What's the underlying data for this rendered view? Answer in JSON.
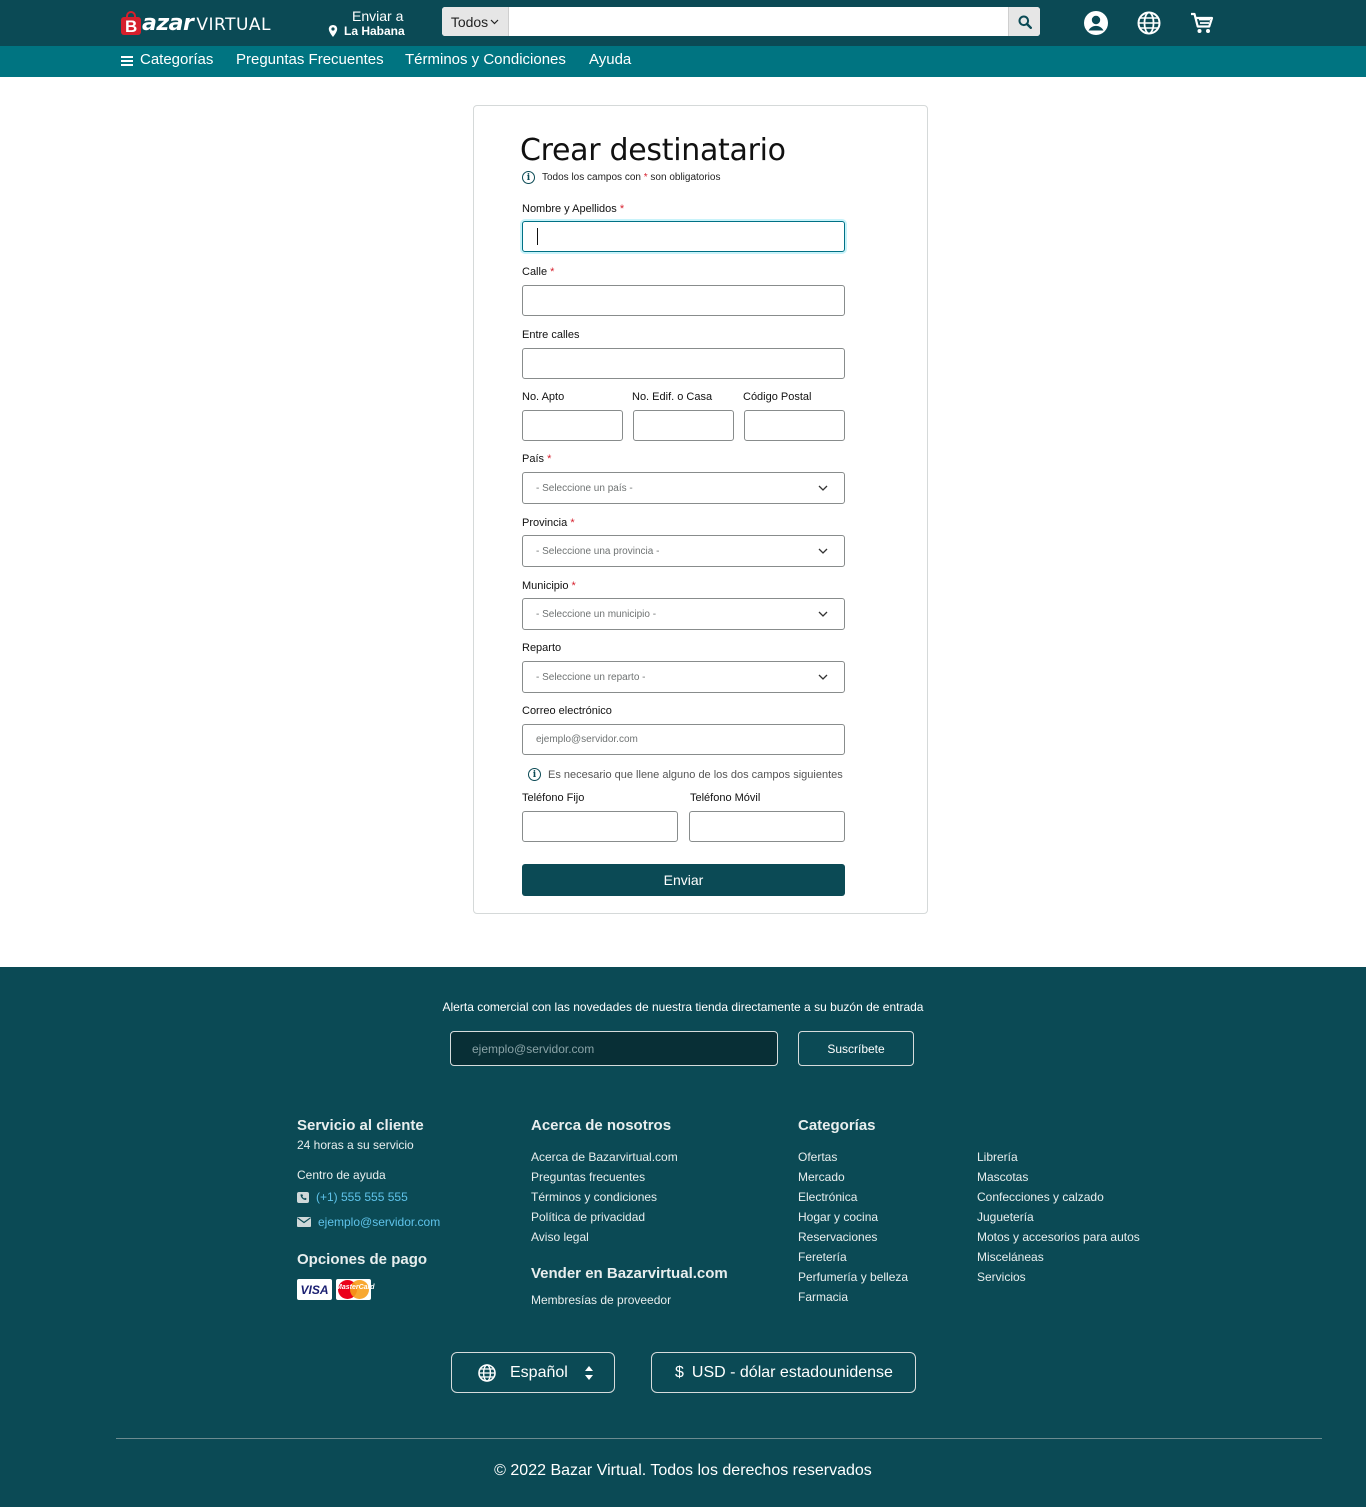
{
  "header": {
    "logo_letter": "B",
    "logo_bold": "azar",
    "logo_light": "VIRTUAL",
    "deliver_line1": "Enviar a",
    "deliver_line2": "La Habana",
    "search_category": "Todos",
    "search_placeholder": "",
    "icons": [
      "account-icon",
      "globe-icon",
      "cart-icon"
    ]
  },
  "nav": {
    "items": [
      "Categorías",
      "Preguntas Frecuentes",
      "Términos y Condiciones",
      "Ayuda"
    ]
  },
  "form": {
    "title": "Crear destinatario",
    "required_note_pre": "Todos los campos con",
    "required_star": "*",
    "required_note_post": "son obligatorios",
    "labels": {
      "name": "Nombre y Apellidos",
      "street": "Calle",
      "between": "Entre calles",
      "apt": "No. Apto",
      "building": "No. Edif. o Casa",
      "postal": "Código Postal",
      "country": "País",
      "province": "Provincia",
      "municipality": "Municipio",
      "district": "Reparto",
      "email": "Correo electrónico",
      "landline": "Teléfono Fijo",
      "mobile": "Teléfono Móvil"
    },
    "selects": {
      "country": "- Seleccione un país -",
      "province": "- Seleccione una provincia -",
      "municipality": "- Seleccione un municipio -",
      "district": "- Seleccione un reparto -"
    },
    "email_placeholder": "ejemplo@servidor.com",
    "phones_note": "Es necesario que llene alguno de los dos campos siguientes",
    "submit_label": "Enviar"
  },
  "footer": {
    "alert": "Alerta comercial con las novedades de nuestra tienda directamente a su buzón de entrada",
    "email_placeholder": "ejemplo@servidor.com",
    "subscribe_label": "Suscríbete",
    "service": {
      "heading": "Servicio al cliente",
      "subtitle": "24 horas a su servicio",
      "help_center": "Centro de ayuda",
      "phone": "(+1) 555 555 555",
      "email": "ejemplo@servidor.com"
    },
    "payment": {
      "heading": "Opciones de pago",
      "visa": "VISA",
      "mastercard": "MasterCard"
    },
    "about": {
      "heading": "Acerca de nosotros",
      "links": [
        "Acerca de Bazarvirtual.com",
        "Preguntas frecuentes",
        "Términos y condiciones",
        "Política de privacidad",
        "Aviso legal"
      ]
    },
    "sell": {
      "heading": "Vender en Bazarvirtual.com",
      "links": [
        "Membresías de proveedor"
      ]
    },
    "categories": {
      "heading": "Categorías",
      "col1": [
        "Ofertas",
        "Mercado",
        "Electrónica",
        "Hogar y cocina",
        "Reservaciones",
        "Feretería",
        "Perfumería y belleza",
        "Farmacia"
      ],
      "col2": [
        "Librería",
        "Mascotas",
        "Confecciones y calzado",
        "Juguetería",
        "Motos y accesorios para autos",
        "Misceláneas",
        "Servicios"
      ]
    },
    "language": "Español",
    "currency_symbol": "$",
    "currency": "USD - dólar estadounidense",
    "copyright": "© 2022  Bazar Virtual. Todos los derechos reservados"
  }
}
